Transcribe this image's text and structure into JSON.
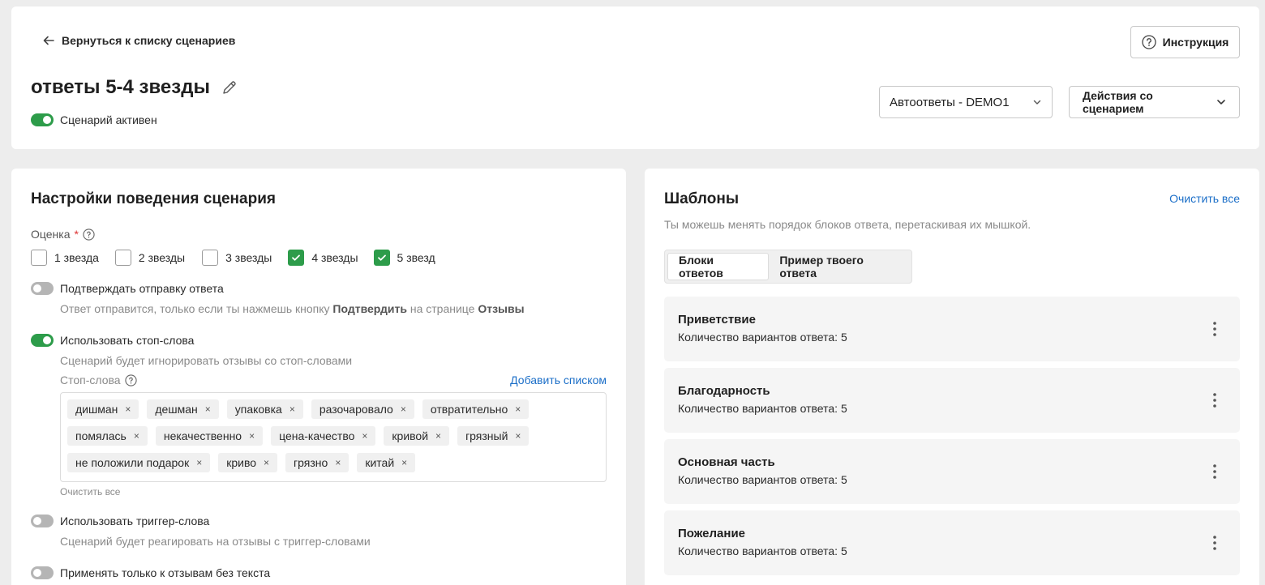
{
  "header": {
    "back_label": "Вернуться к списку сценариев",
    "title": "ответы 5-4 звезды",
    "active_label": "Сценарий активен",
    "instruction_label": "Инструкция",
    "account_select": "Автоответы - DEMO1",
    "actions_label": "Действия со сценарием"
  },
  "settings": {
    "title": "Настройки поведения сценария",
    "rating_label": "Оценка",
    "rating_required": "*",
    "ratings": [
      {
        "label": "1 звезда",
        "checked": false
      },
      {
        "label": "2 звезды",
        "checked": false
      },
      {
        "label": "3 звезды",
        "checked": false
      },
      {
        "label": "4 звезды",
        "checked": true
      },
      {
        "label": "5 звезд",
        "checked": true
      }
    ],
    "confirm": {
      "label": "Подтверждать отправку ответа",
      "desc_prefix": "Ответ отправится, только если ты нажмешь кнопку ",
      "desc_bold1": "Подтвердить",
      "desc_mid": " на странице ",
      "desc_bold2": "Отзывы"
    },
    "stopwords": {
      "label": "Использовать стоп-слова",
      "desc": "Сценарий будет игнорировать отзывы со стоп-словами",
      "field_label": "Стоп-слова",
      "add_list": "Добавить списком",
      "tags": [
        "дишман",
        "дешман",
        "упаковка",
        "разочаровало",
        "отвратительно",
        "помялась",
        "некачественно",
        "цена-качество",
        "кривой",
        "грязный",
        "не положили подарок",
        "криво",
        "грязно",
        "китай"
      ],
      "clear_all": "Очистить все",
      "tag_remove": "×"
    },
    "trigger": {
      "label": "Использовать триггер-слова",
      "desc": "Сценарий будет реагировать на отзывы с триггер-словами"
    },
    "no_text": {
      "label": "Применять только к отзывам без текста"
    }
  },
  "templates": {
    "title": "Шаблоны",
    "clear_all": "Очистить все",
    "desc": "Ты можешь менять порядок блоков ответа, перетаскивая их мышкой.",
    "tabs": [
      {
        "label": "Блоки ответов",
        "active": true
      },
      {
        "label": "Пример твоего ответа",
        "active": false
      }
    ],
    "blocks": [
      {
        "title": "Приветствие",
        "count": "Количество вариантов ответа: 5"
      },
      {
        "title": "Благодарность",
        "count": "Количество вариантов ответа: 5"
      },
      {
        "title": "Основная часть",
        "count": "Количество вариантов ответа: 5"
      },
      {
        "title": "Пожелание",
        "count": "Количество вариантов ответа: 5"
      }
    ]
  },
  "colors": {
    "accent_green": "#2d9c4a",
    "link_blue": "#1c6fc8",
    "page_bg": "#ededed"
  }
}
